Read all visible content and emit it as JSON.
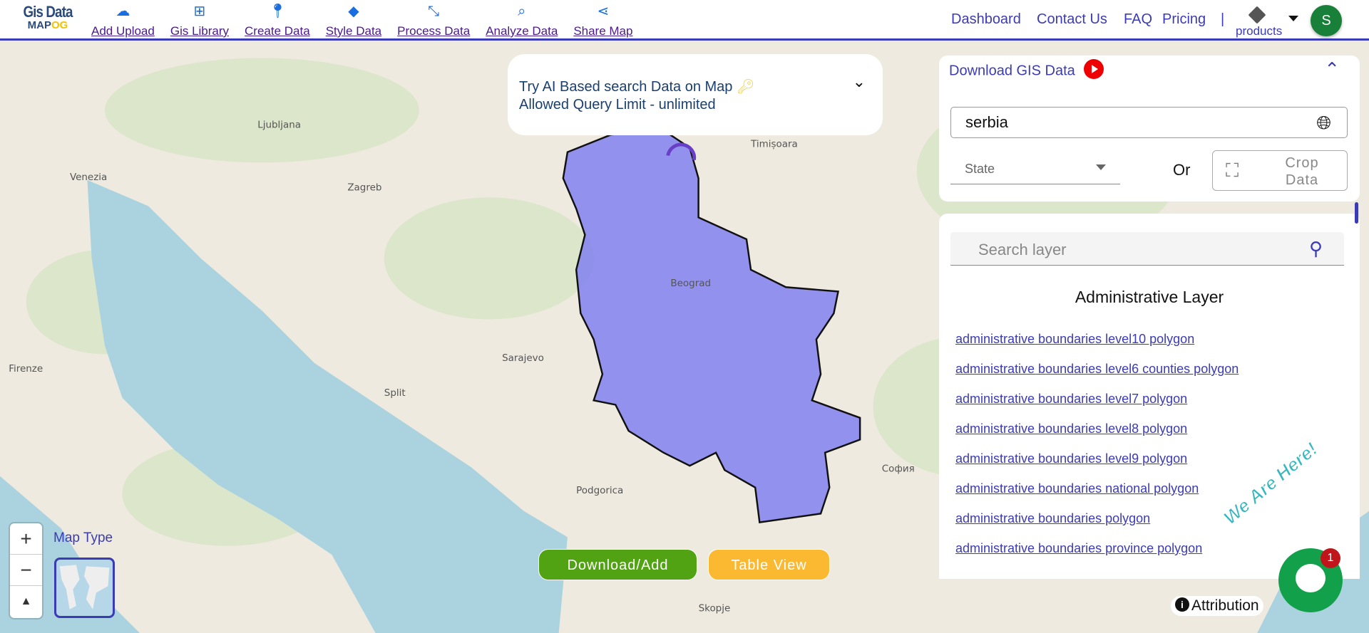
{
  "header": {
    "logo": {
      "line1": "Gis Data",
      "line2a": "MAP",
      "line2b": "OG"
    },
    "nav": [
      {
        "label": "Add Upload",
        "icon": "cloud-upload-icon"
      },
      {
        "label": "Gis Library",
        "icon": "library-add-icon"
      },
      {
        "label": "Create Data",
        "icon": "map-pin-icon"
      },
      {
        "label": "Style Data",
        "icon": "paint-bucket-icon"
      },
      {
        "label": "Process Data",
        "icon": "process-icon"
      },
      {
        "label": "Analyze Data",
        "icon": "analyze-icon"
      },
      {
        "label": "Share Map",
        "icon": "share-icon"
      }
    ],
    "right_links": [
      "Dashboard",
      "Contact Us",
      "FAQ",
      "Pricing"
    ],
    "separator": "|",
    "products_label": "products",
    "avatar_letter": "S"
  },
  "ai_search": {
    "line1": "Try AI Based search Data on Map",
    "line2": "Allowed Query Limit - unlimited"
  },
  "download_panel": {
    "title": "Download GIS Data",
    "country_value": "serbia",
    "state_placeholder": "State",
    "or_label": "Or",
    "crop_label_1": "Crop",
    "crop_label_2": "Data"
  },
  "layers_panel": {
    "search_placeholder": "Search layer",
    "title": "Administrative Layer",
    "items": [
      "administrative boundaries level10 polygon",
      "administrative boundaries level6 counties polygon",
      "administrative boundaries level7 polygon",
      "administrative boundaries level8 polygon",
      "administrative boundaries level9 polygon",
      "administrative boundaries national polygon",
      "administrative boundaries polygon",
      "administrative boundaries province polygon"
    ]
  },
  "buttons": {
    "download_add": "Download/Add",
    "table_view": "Table View"
  },
  "map": {
    "map_type_label": "Map Type",
    "zoom_in": "+",
    "zoom_out": "−",
    "attribution": "Attribution",
    "highlight_color": "#7b7bf0",
    "place_labels": [
      "Zagreb",
      "Beograd",
      "Sarajevo",
      "Timișoara",
      "Podgorica",
      "Skopje",
      "София",
      "Split",
      "Venezia",
      "Firenze",
      "Ljubljana"
    ]
  },
  "chat": {
    "badge": "1",
    "banner": "We Are Here!"
  }
}
